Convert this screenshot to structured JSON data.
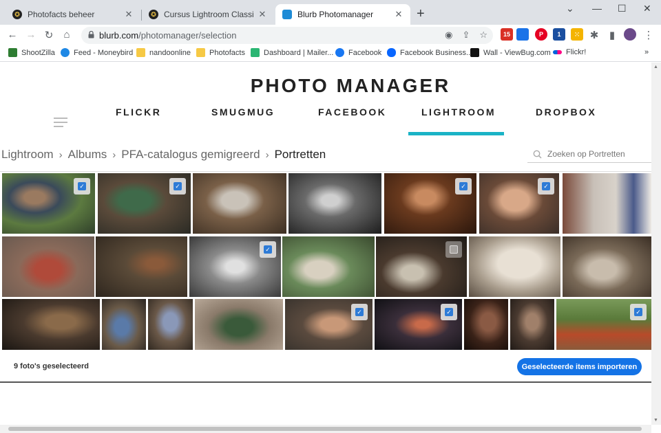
{
  "browser": {
    "tabs": [
      {
        "title": "Photofacts beheer",
        "close": "✕"
      },
      {
        "title": "Cursus Lightroom Classic Module",
        "close": "✕"
      },
      {
        "title": "Blurb Photomanager",
        "close": "✕"
      }
    ],
    "new_tab": "+",
    "window_controls": {
      "menu": "⌄",
      "minimize": "—",
      "maximize": "☐",
      "close": "✕"
    },
    "url_host": "blurb.com",
    "url_path": "/photomanager/selection",
    "extensions": [
      {
        "icon": "gmail-icon",
        "color": "#d93025",
        "badge": "15"
      },
      {
        "icon": "calendar-ext-icon",
        "color": "#1a73e8",
        "badge": ""
      },
      {
        "icon": "pinterest-icon",
        "color": "#e60023",
        "badge": ""
      },
      {
        "icon": "ext-blue-icon",
        "color": "#1a4fa0",
        "badge": "1"
      },
      {
        "icon": "grid-ext-icon",
        "color": "#f4b400",
        "badge": ""
      }
    ],
    "bookmarks": [
      {
        "label": "ShootZilla",
        "color": "#2e7d32"
      },
      {
        "label": "Feed - Moneybird",
        "color": "#1e88e5"
      },
      {
        "label": "nandoonline",
        "color": "#f6c945"
      },
      {
        "label": "Photofacts",
        "color": "#f6c945"
      },
      {
        "label": "Dashboard | Mailer...",
        "color": "#2bb673"
      },
      {
        "label": "Facebook",
        "color": "#1877f2"
      },
      {
        "label": "Facebook Business...",
        "color": "#0866ff"
      },
      {
        "label": "Wall - ViewBug.com",
        "color": "#111111"
      },
      {
        "label": "Flickr!",
        "color": "#ff0084"
      }
    ],
    "bookmarks_more": "»"
  },
  "app": {
    "title": "PHOTO MANAGER",
    "services": [
      "FLICKR",
      "SMUGMUG",
      "FACEBOOK",
      "LIGHTROOM",
      "DROPBOX"
    ],
    "active_service": "LIGHTROOM",
    "breadcrumb": [
      "Lightroom",
      "Albums",
      "PFA-catalogus gemigreerd",
      "Portretten"
    ],
    "breadcrumb_sep": "›",
    "search_placeholder": "Zoeken op Portretten",
    "selected_count_text": "9 foto's geselecteerd",
    "import_label": "Geselecteerde items importeren",
    "accent_color": "#1ab3c6",
    "button_color": "#1473e6"
  },
  "photos": [
    {
      "row": 1,
      "checked": true
    },
    {
      "row": 1,
      "checked": true
    },
    {
      "row": 1,
      "checked": false
    },
    {
      "row": 1,
      "checked": false
    },
    {
      "row": 1,
      "checked": true
    },
    {
      "row": 1,
      "checked": true
    },
    {
      "row": 1,
      "checked": false
    },
    {
      "row": 2,
      "checked": false
    },
    {
      "row": 2,
      "checked": false
    },
    {
      "row": 2,
      "checked": true
    },
    {
      "row": 2,
      "checked": false
    },
    {
      "row": 2,
      "checked": false,
      "dim_checkbox": true
    },
    {
      "row": 2,
      "checked": false
    },
    {
      "row": 2,
      "checked": false
    },
    {
      "row": 3,
      "checked": false
    },
    {
      "row": 3,
      "checked": false
    },
    {
      "row": 3,
      "checked": false
    },
    {
      "row": 3,
      "checked": false
    },
    {
      "row": 3,
      "checked": true
    },
    {
      "row": 3,
      "checked": true
    },
    {
      "row": 3,
      "checked": false
    },
    {
      "row": 3,
      "checked": false
    },
    {
      "row": 3,
      "checked": true
    }
  ]
}
